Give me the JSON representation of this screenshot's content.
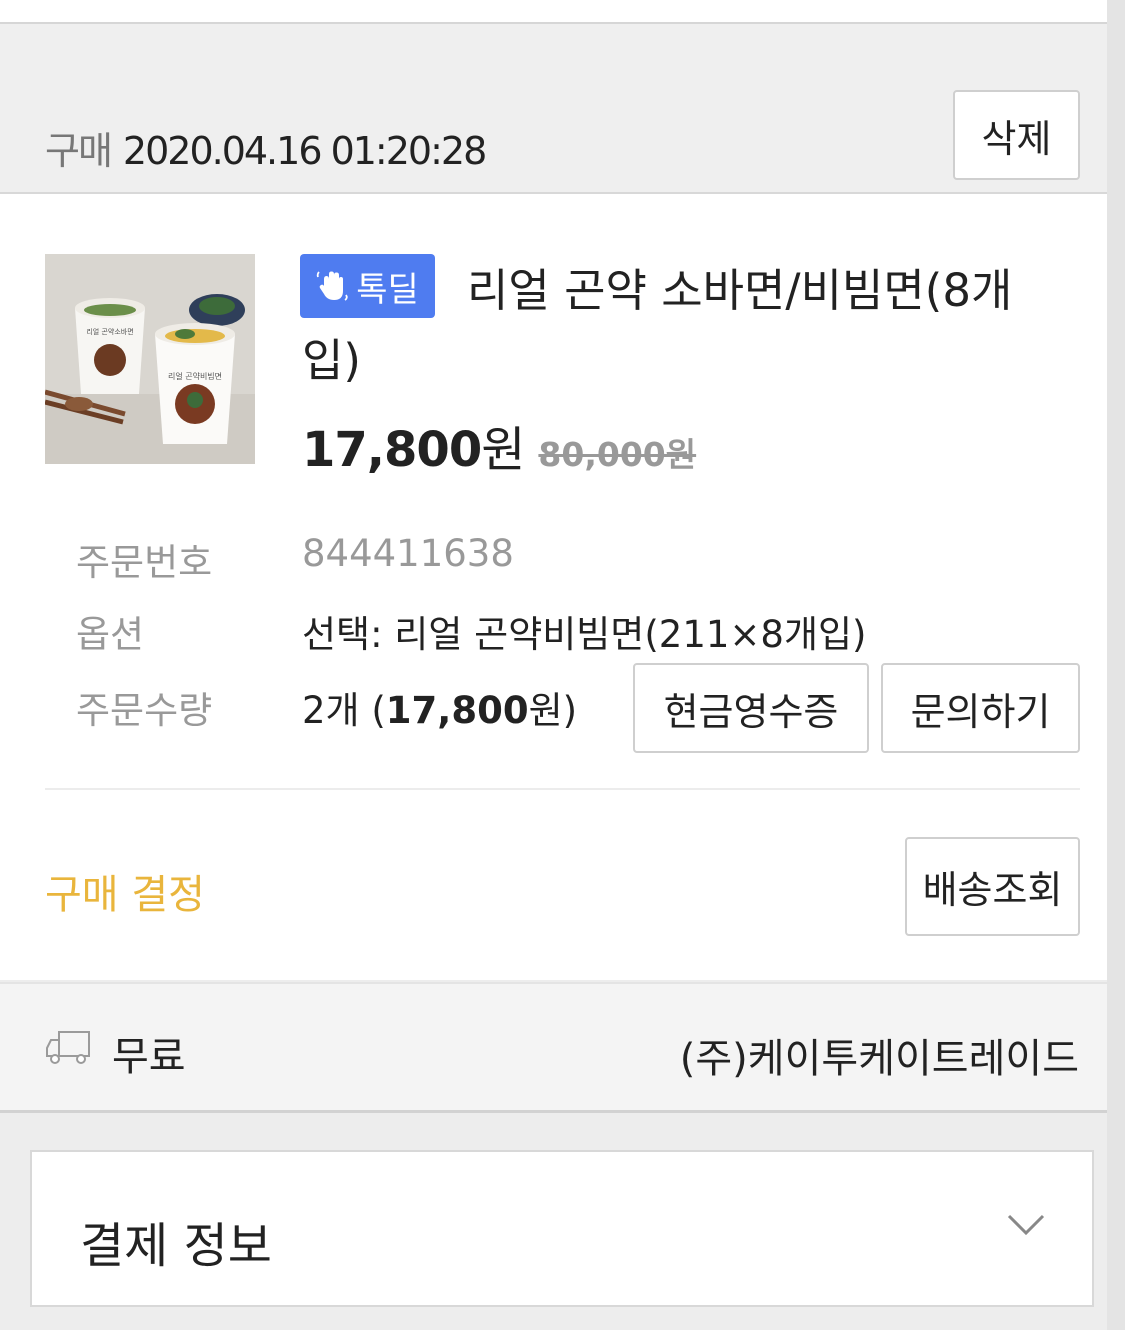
{
  "order": {
    "purchase_label": "구매",
    "purchase_datetime": "2020.04.16 01:20:28",
    "delete_label": "삭제"
  },
  "product": {
    "badge_label": "톡딜",
    "badge_color": "#4f7cf0",
    "title": "리얼 곤약 소바면/비빔면(8개입)",
    "price_number": "17,800",
    "price_unit": "원",
    "original_price": "80,000원",
    "image": {
      "cup_label_small": "리얼 곤약소바면",
      "cup_label_big": "리얼 곤약비빔면"
    }
  },
  "details": {
    "order_no_label": "주문번호",
    "order_no": "844411638",
    "option_label": "옵션",
    "option_value": "선택: 리얼 곤약비빔면(211×8개입)",
    "qty_label": "주문수량",
    "qty_prefix": "2개 (",
    "qty_amount": "17,800",
    "qty_suffix": "원)"
  },
  "actions": {
    "receipt_label": "현금영수증",
    "inquiry_label": "문의하기",
    "track_label": "배송조회"
  },
  "status": {
    "label": "구매 결정",
    "color": "#e9b53c"
  },
  "shipping": {
    "icon": "truck-icon",
    "fee": "무료",
    "seller": "(주)케이투케이트레이드"
  },
  "payment": {
    "title": "결제 정보",
    "icon": "chevron-down-icon"
  }
}
